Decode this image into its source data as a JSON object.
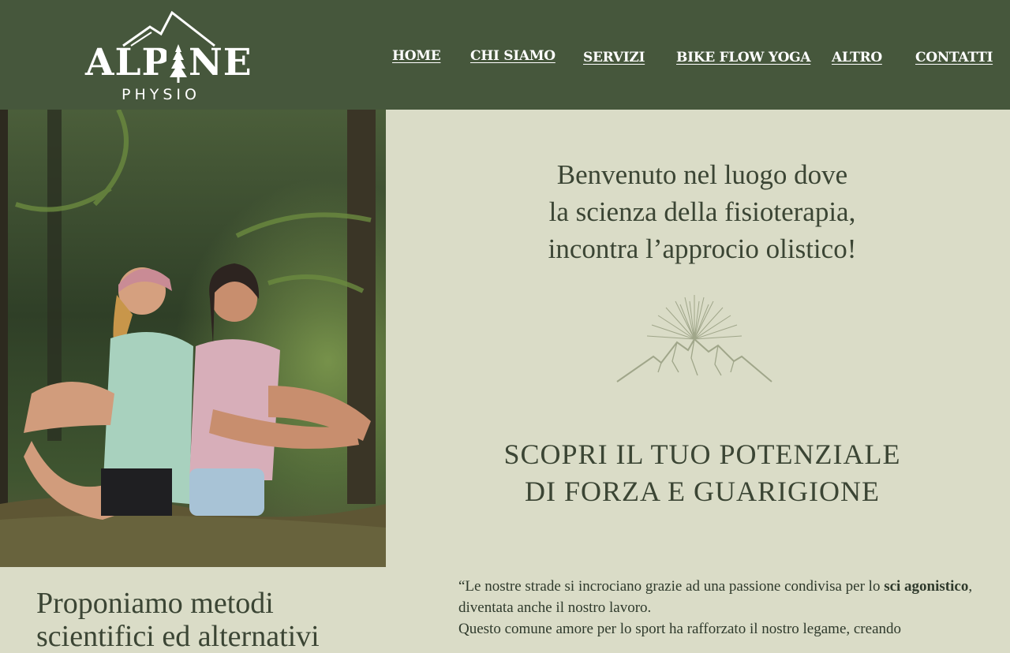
{
  "brand": {
    "name": "ALPINE",
    "sub": "PHYSIO",
    "header_bg": "#46573c",
    "page_bg": "#dadcc7"
  },
  "nav": {
    "items": [
      {
        "label": "HOME"
      },
      {
        "label": "CHI SIAMO"
      },
      {
        "label": "SERVIZI"
      },
      {
        "label": "BIKE FLOW YOGA"
      },
      {
        "label": "ALTRO"
      },
      {
        "label": "CONTATTI"
      }
    ]
  },
  "hero": {
    "image_subject": "two-women-sitting-back-to-back-in-forest",
    "welcome_lines": [
      "Benvenuto nel luogo dove",
      "la scienza della fisioterapia,",
      "incontra l’approcio olistico!"
    ],
    "icon": "sun-over-mountains-icon",
    "tagline_lines": [
      "SCOPRI IL TUO POTENZIALE",
      "DI FORZA E GUARIGIONE"
    ]
  },
  "about": {
    "heading_lines": [
      "Proponiamo metodi",
      "scientifici ed alternativi"
    ],
    "quote": {
      "p1_before": "“Le nostre strade si incrociano grazie ad una passione condivisa per lo ",
      "p1_bold": "sci agonistico",
      "p1_after": ", diventata anche il nostro lavoro.",
      "p2": "Questo comune amore per lo sport ha rafforzato il nostro legame, creando"
    }
  }
}
